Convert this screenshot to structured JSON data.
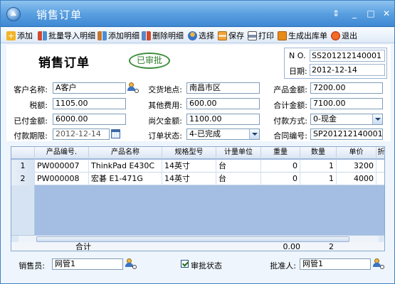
{
  "window": {
    "title": "销售订单"
  },
  "toolbar": {
    "items": [
      {
        "label": "添加",
        "icon": "add-icon"
      },
      {
        "label": "批量导入明细",
        "icon": "batch-import-icon"
      },
      {
        "label": "添加明细",
        "icon": "add-detail-icon"
      },
      {
        "label": "删除明细",
        "icon": "delete-detail-icon"
      },
      {
        "label": "选择",
        "icon": "select-icon"
      },
      {
        "label": "保存",
        "icon": "save-icon"
      },
      {
        "label": "打印",
        "icon": "print-icon"
      },
      {
        "label": "生成出库单",
        "icon": "outbound-icon"
      },
      {
        "label": "退出",
        "icon": "exit-icon"
      }
    ]
  },
  "form": {
    "title": "销售订单",
    "stamp": "已审批",
    "no_label": "N O.",
    "no_value": "SS201212140001",
    "date_label": "日期:",
    "date_value": "2012-12-14",
    "fields": {
      "customer_label": "客户名称:",
      "customer_value": "A客户",
      "location_label": "交货地点:",
      "location_value": "南昌市区",
      "product_amount_label": "产品金额:",
      "product_amount_value": "7200.00",
      "tax_label": "税额:",
      "tax_value": "1105.00",
      "other_fee_label": "其他费用:",
      "other_fee_value": "600.00",
      "total_amount_label": "合计金额:",
      "total_amount_value": "7100.00",
      "paid_label": "已付金额:",
      "paid_value": "6000.00",
      "owed_label": "尚欠金额:",
      "owed_value": "1100.00",
      "pay_method_label": "付款方式:",
      "pay_method_value": "0-现金",
      "pay_deadline_label": "付款期限:",
      "pay_deadline_value": "2012-12-14",
      "order_status_label": "订单状态:",
      "order_status_value": "4-已完成",
      "contract_no_label": "合同编号:",
      "contract_no_value": "SP201212140001"
    }
  },
  "grid": {
    "columns": [
      "产品编号.",
      "产品名称",
      "规格型号",
      "计量单位",
      "重量",
      "数量",
      "单价",
      "折"
    ],
    "rows": [
      {
        "num": "1",
        "code": "PW000007",
        "name": "ThinkPad E430C",
        "spec": "14英寸",
        "unit": "台",
        "weight": "0",
        "qty": "1",
        "price": "3200"
      },
      {
        "num": "2",
        "code": "PW000008",
        "name": "宏碁 E1-471G",
        "spec": "14英寸",
        "unit": "台",
        "weight": "0",
        "qty": "1",
        "price": "4000"
      }
    ],
    "totals": {
      "label": "合计",
      "weight": "0.00",
      "qty": "2"
    }
  },
  "footer": {
    "salesperson_label": "销售员:",
    "salesperson_value": "网管1",
    "approval_label": "审批状态",
    "approval_checked": true,
    "approver_label": "批准人:",
    "approver_value": "网管1"
  },
  "colors": {
    "titlebar": "#5aa0e0",
    "grid_bg": "#a3bee2",
    "stamp": "#2f812f"
  }
}
